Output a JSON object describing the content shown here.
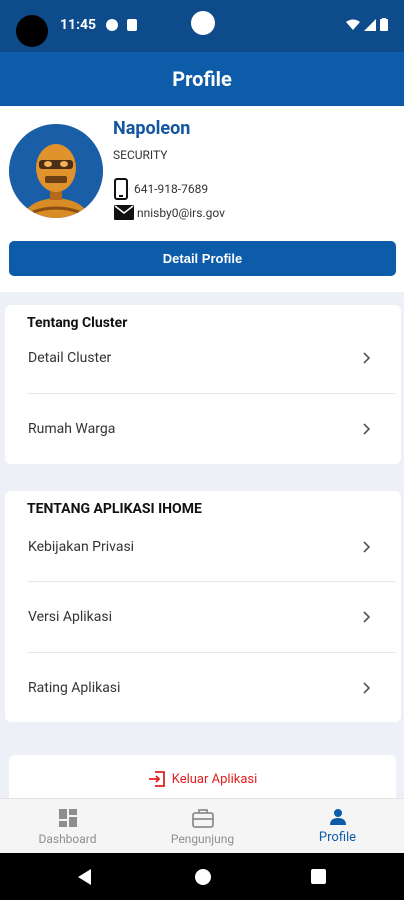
{
  "status_bar": {
    "time": "11:45"
  },
  "appbar": {
    "title": "Profile"
  },
  "profile": {
    "name": "Napoleon",
    "role": "SECURITY",
    "phone": "641-918-7689",
    "email": "nnisby0@irs.gov",
    "detail_button": "Detail Profile"
  },
  "cluster_section": {
    "title": "Tentang Cluster",
    "items": [
      {
        "label": "Detail Cluster"
      },
      {
        "label": "Rumah Warga"
      }
    ]
  },
  "app_section": {
    "title": "TENTANG APLIKASI IHOME",
    "items": [
      {
        "label": "Kebijakan Privasi"
      },
      {
        "label": "Versi Aplikasi"
      },
      {
        "label": "Rating Aplikasi"
      }
    ]
  },
  "logout": {
    "label": "Keluar Aplikasi",
    "icon": "logout-icon",
    "color": "#e02020"
  },
  "bottom_nav": {
    "items": [
      {
        "label": "Dashboard",
        "icon": "dashboard-icon"
      },
      {
        "label": "Pengunjung",
        "icon": "briefcase-icon"
      },
      {
        "label": "Profile",
        "icon": "person-icon",
        "active": true
      }
    ]
  },
  "colors": {
    "primary": "#0d5ca9",
    "status_bar": "#0d4b8b",
    "name": "#1255a1"
  }
}
